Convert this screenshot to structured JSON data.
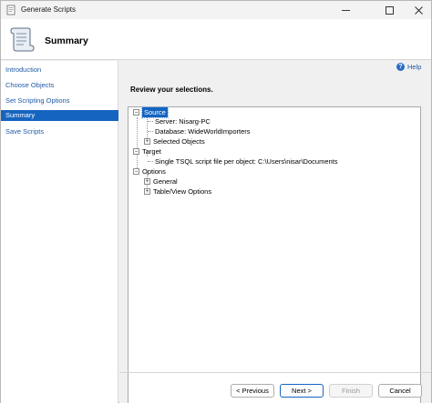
{
  "window": {
    "title": "Generate Scripts",
    "controls": {
      "minimize_icon": "minimize-icon",
      "maximize_icon": "maximize-icon",
      "close_icon": "close-icon"
    }
  },
  "header": {
    "title": "Summary",
    "icon": "scroll-icon"
  },
  "sidebar": {
    "items": [
      {
        "label": "Introduction",
        "selected": false
      },
      {
        "label": "Choose Objects",
        "selected": false
      },
      {
        "label": "Set Scripting Options",
        "selected": false
      },
      {
        "label": "Summary",
        "selected": true
      },
      {
        "label": "Save Scripts",
        "selected": false
      }
    ]
  },
  "content": {
    "help_label": "Help",
    "review_label": "Review your selections."
  },
  "tree": {
    "source": {
      "label": "Source",
      "server": "Server: Nisarg-PC",
      "database": "Database: WideWorldImporters",
      "selected_objects": "Selected Objects"
    },
    "target": {
      "label": "Target",
      "file": "Single TSQL script file per object: C:\\Users\\nisar\\Documents"
    },
    "options": {
      "label": "Options",
      "general": "General",
      "table_view": "Table/View Options"
    },
    "expand_symbol": "+",
    "collapse_symbol": "−"
  },
  "footer": {
    "previous_label": "< Previous",
    "next_label": "Next >",
    "finish_label": "Finish",
    "cancel_label": "Cancel"
  },
  "colors": {
    "selection": "#1565c0",
    "link": "#1f5aa6"
  }
}
